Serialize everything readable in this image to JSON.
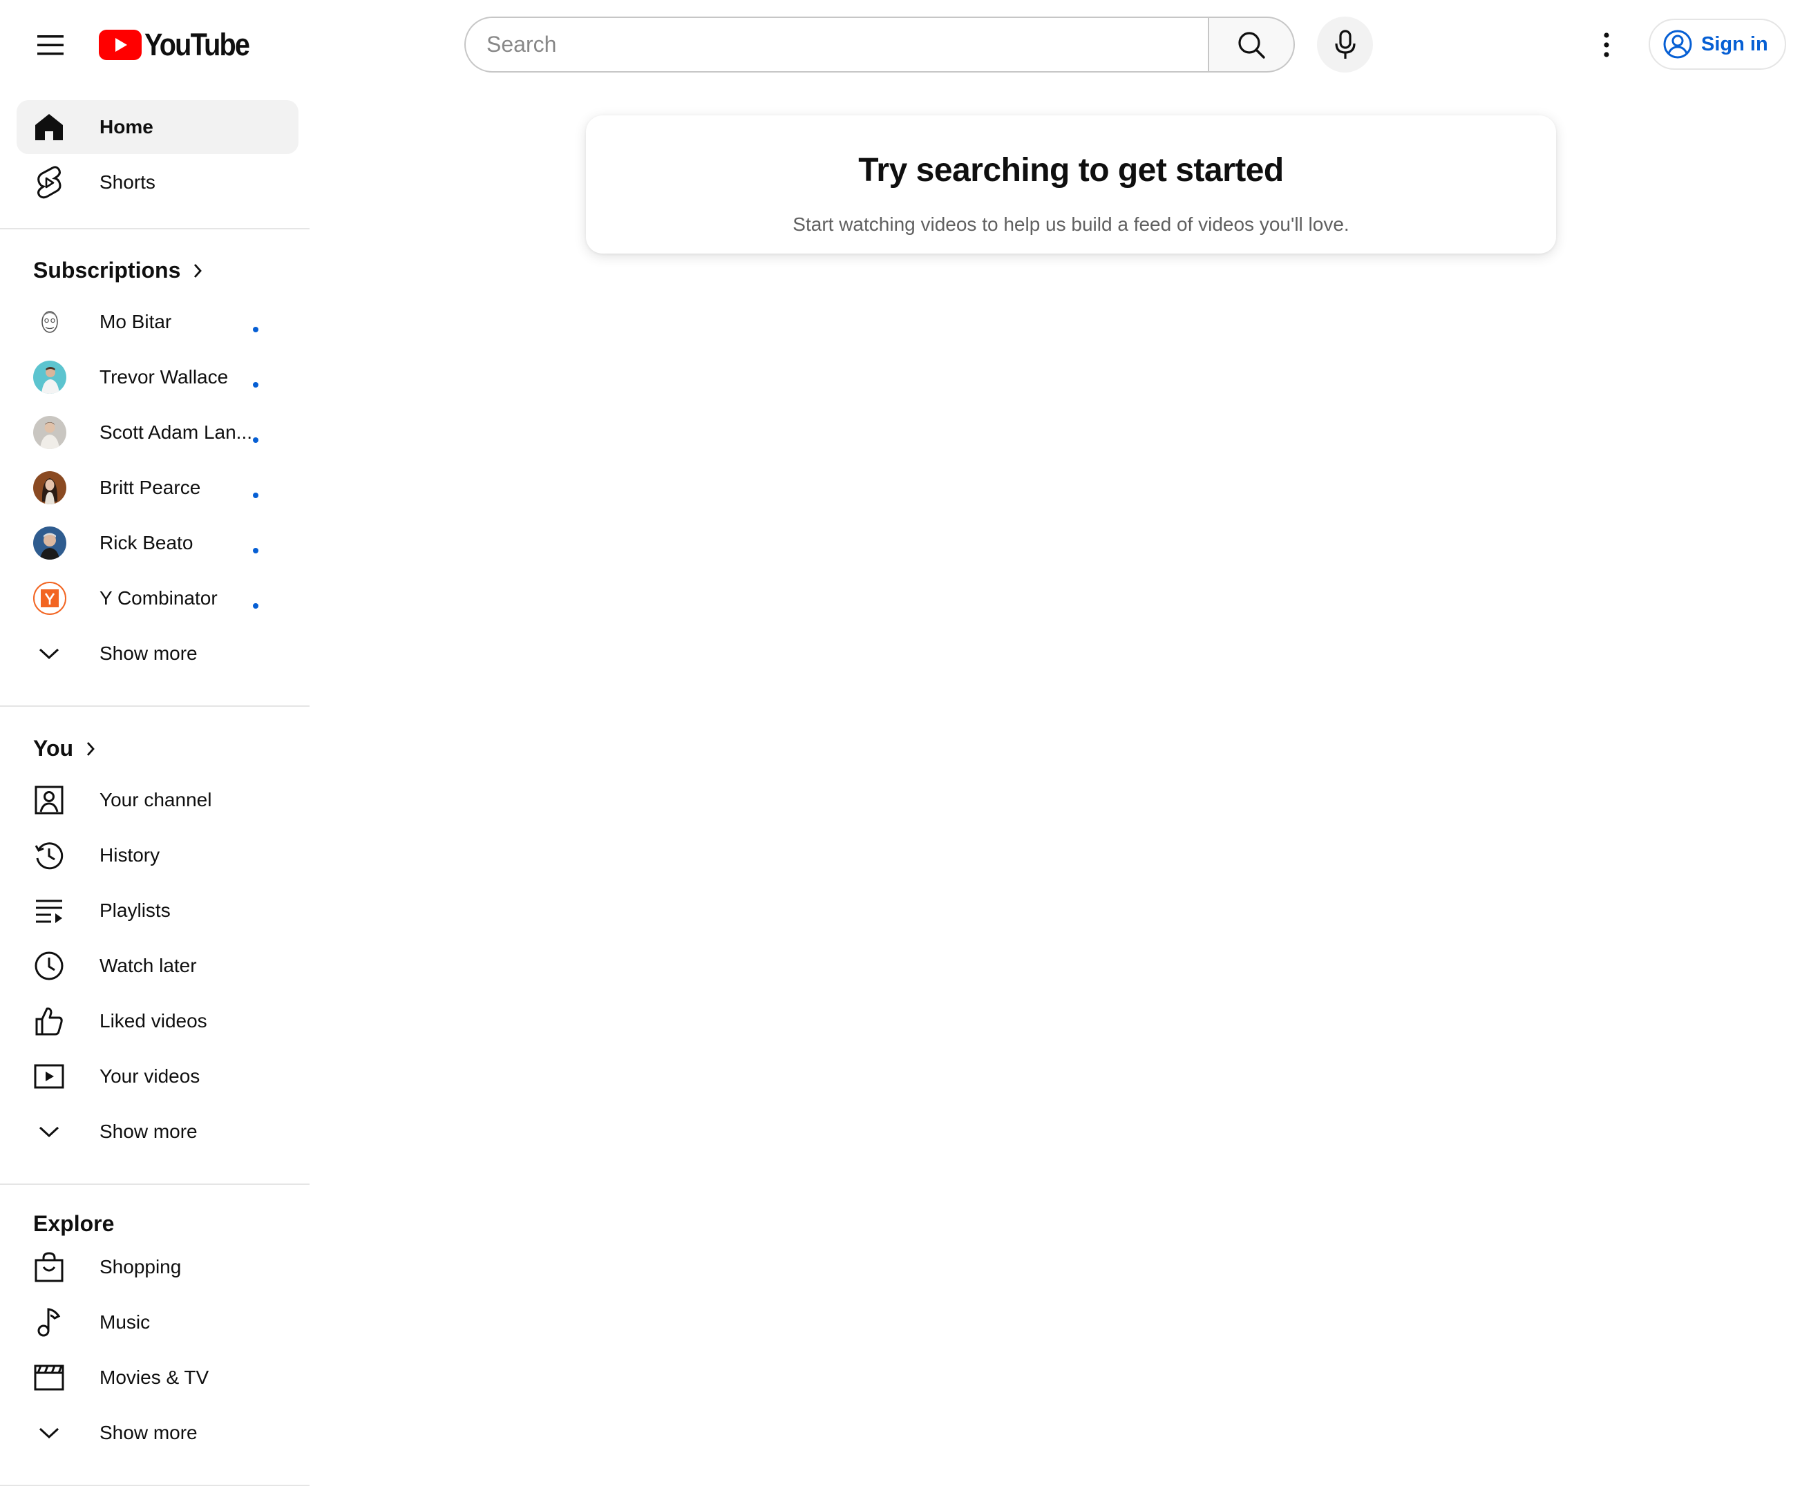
{
  "header": {
    "logo_text": "YouTube",
    "search_placeholder": "Search",
    "sign_in_label": "Sign in"
  },
  "sidebar": {
    "primary": [
      {
        "label": "Home",
        "icon": "home-icon",
        "active": true
      },
      {
        "label": "Shorts",
        "icon": "shorts-icon",
        "active": false
      }
    ],
    "subscriptions": {
      "title": "Subscriptions",
      "channels": [
        {
          "name": "Mo Bitar",
          "avatar": "mo-bitar-avatar",
          "new_content": true
        },
        {
          "name": "Trevor Wallace",
          "avatar": "trevor-wallace-avatar",
          "new_content": true
        },
        {
          "name": "Scott Adam Lan...",
          "avatar": "scott-adam-avatar",
          "new_content": true
        },
        {
          "name": "Britt Pearce",
          "avatar": "britt-pearce-avatar",
          "new_content": true
        },
        {
          "name": "Rick Beato",
          "avatar": "rick-beato-avatar",
          "new_content": true
        },
        {
          "name": "Y Combinator",
          "avatar": "y-combinator-avatar",
          "new_content": true
        }
      ],
      "show_more": "Show more"
    },
    "you": {
      "title": "You",
      "items": [
        {
          "label": "Your channel",
          "icon": "your-channel-icon"
        },
        {
          "label": "History",
          "icon": "history-icon"
        },
        {
          "label": "Playlists",
          "icon": "playlists-icon"
        },
        {
          "label": "Watch later",
          "icon": "watch-later-icon"
        },
        {
          "label": "Liked videos",
          "icon": "liked-videos-icon"
        },
        {
          "label": "Your videos",
          "icon": "your-videos-icon"
        }
      ],
      "show_more": "Show more"
    },
    "explore": {
      "title": "Explore",
      "items": [
        {
          "label": "Shopping",
          "icon": "shopping-icon"
        },
        {
          "label": "Music",
          "icon": "music-icon"
        },
        {
          "label": "Movies & TV",
          "icon": "movies-tv-icon"
        }
      ],
      "show_more": "Show more"
    }
  },
  "main": {
    "prompt_title": "Try searching to get started",
    "prompt_subtitle": "Start watching videos to help us build a feed of videos you'll love."
  },
  "colors": {
    "brand_red": "#ff0000",
    "link_blue": "#065fd4",
    "active_bg": "#f2f2f2",
    "text_primary": "#0f0f0f",
    "text_secondary": "#606060"
  }
}
